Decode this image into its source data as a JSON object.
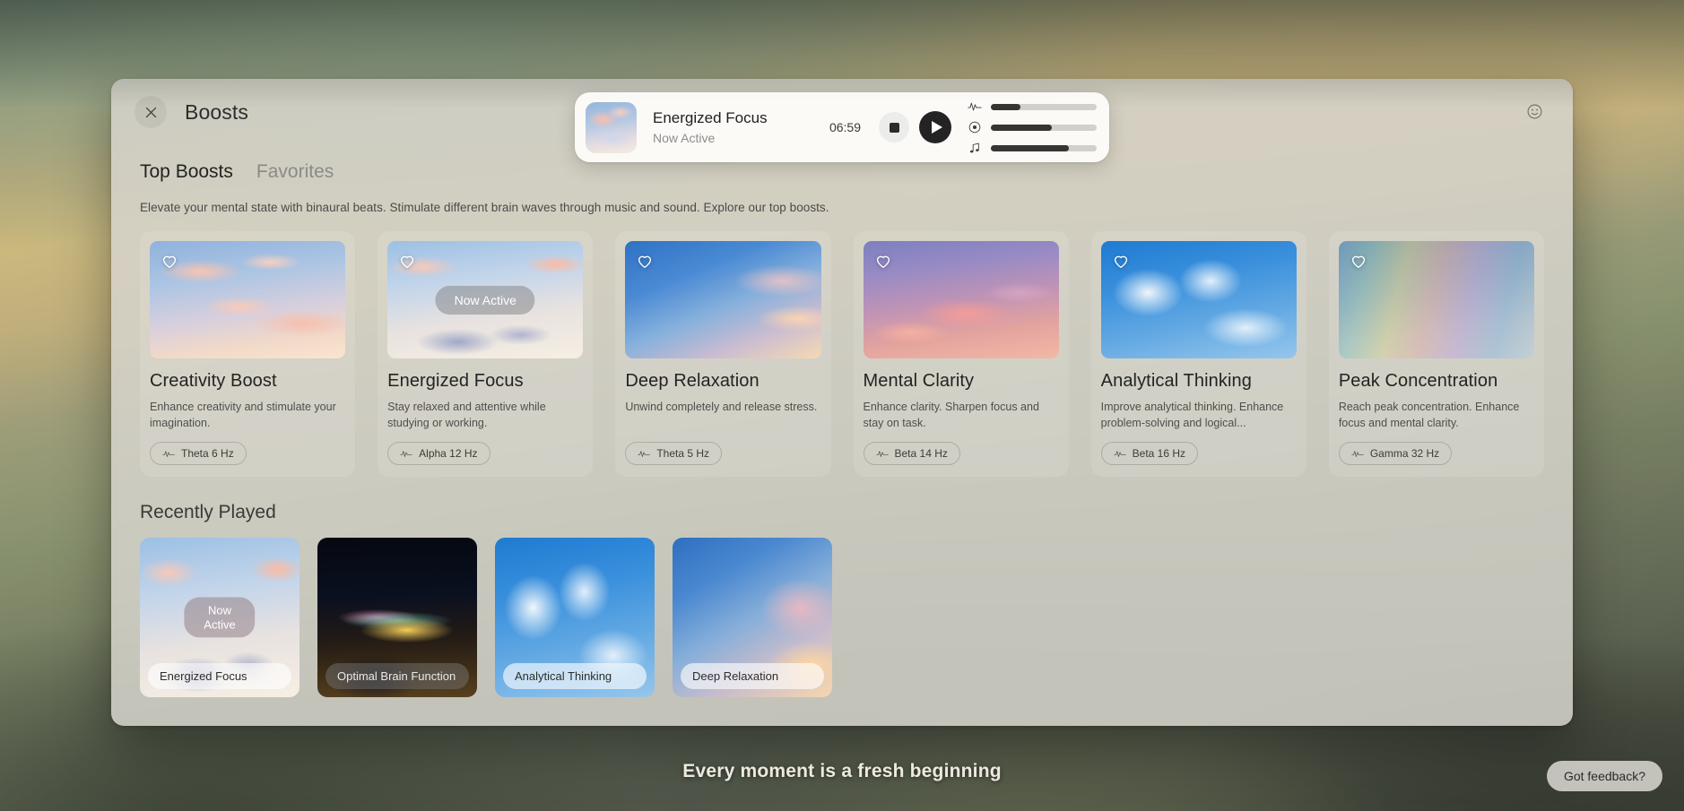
{
  "window": {
    "title": "Boosts",
    "close_icon": "close-icon",
    "smiley_icon": "smiley-face-icon"
  },
  "player": {
    "track_title": "Energized Focus",
    "status": "Now Active",
    "time": "06:59",
    "stop_icon": "stop-icon",
    "play_icon": "play-icon",
    "sliders": [
      {
        "icon": "waveform-icon",
        "name": "binaural-beat-volume",
        "fill_percent": 28
      },
      {
        "icon": "target-circle-icon",
        "name": "ambient-tone-volume",
        "fill_percent": 58
      },
      {
        "icon": "music-note-icon",
        "name": "music-volume",
        "fill_percent": 74
      }
    ]
  },
  "tabs": [
    {
      "label": "Top Boosts",
      "active": true
    },
    {
      "label": "Favorites",
      "active": false
    }
  ],
  "section_description": "Elevate your mental state with binaural beats. Stimulate different brain waves through music and sound. Explore our top boosts.",
  "boosts": [
    {
      "name": "Creativity Boost",
      "description": "Enhance creativity and stimulate your imagination.",
      "frequency": "Theta 6 Hz",
      "now_active": false,
      "favorite_icon": "heart-outline-icon",
      "art": "art-creativity"
    },
    {
      "name": "Energized Focus",
      "description": "Stay relaxed and attentive while studying or working.",
      "frequency": "Alpha 12 Hz",
      "now_active": true,
      "now_active_label": "Now Active",
      "favorite_icon": "heart-outline-icon",
      "art": "art-energized"
    },
    {
      "name": "Deep Relaxation",
      "description": "Unwind completely and release stress.",
      "frequency": "Theta 5 Hz",
      "now_active": false,
      "favorite_icon": "heart-outline-icon",
      "art": "art-deep"
    },
    {
      "name": "Mental Clarity",
      "description": "Enhance clarity. Sharpen focus and stay on task.",
      "frequency": "Beta 14 Hz",
      "now_active": false,
      "favorite_icon": "heart-outline-icon",
      "art": "art-mental"
    },
    {
      "name": "Analytical Thinking",
      "description": "Improve analytical thinking. Enhance problem-solving and logical...",
      "frequency": "Beta 16 Hz",
      "now_active": false,
      "favorite_icon": "heart-outline-icon",
      "art": "art-analytical"
    },
    {
      "name": "Peak Concentration",
      "description": "Reach peak concentration. Enhance focus and mental clarity.",
      "frequency": "Gamma 32 Hz",
      "now_active": false,
      "favorite_icon": "heart-outline-icon",
      "art": "art-peak"
    }
  ],
  "recent": {
    "heading": "Recently Played",
    "items": [
      {
        "label": "Energized Focus",
        "badge": "Now\nActive",
        "dark": false,
        "art": "art-energized"
      },
      {
        "label": "Optimal Brain Function",
        "badge": null,
        "dark": true,
        "art": "art-brain"
      },
      {
        "label": "Analytical Thinking",
        "badge": null,
        "dark": false,
        "art": "art-analytical"
      },
      {
        "label": "Deep Relaxation",
        "badge": null,
        "dark": false,
        "art": "art-relax2"
      }
    ]
  },
  "desktop": {
    "tagline": "Every moment is a fresh beginning",
    "feedback_label": "Got feedback?"
  }
}
